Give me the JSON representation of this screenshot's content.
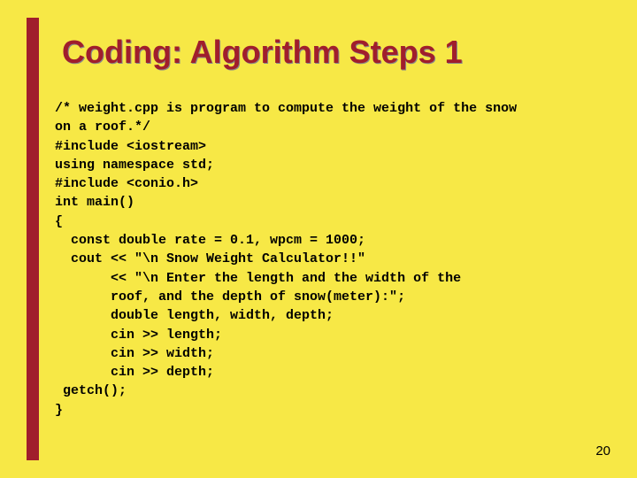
{
  "slide": {
    "title": "Coding: Algorithm Steps 1",
    "page_number": "20",
    "code_lines": [
      "/* weight.cpp is program to compute the weight of the snow",
      "on a roof.*/",
      "#include <iostream>",
      "using namespace std;",
      "#include <conio.h>",
      "int main()",
      "{",
      "  const double rate = 0.1, wpcm = 1000;",
      "  cout << \"\\n Snow Weight Calculator!!\"",
      "       << \"\\n Enter the length and the width of the",
      "       roof, and the depth of snow(meter):\";",
      "       double length, width, depth;",
      "       cin >> length;",
      "       cin >> width;",
      "       cin >> depth;",
      " getch();",
      "}"
    ]
  }
}
